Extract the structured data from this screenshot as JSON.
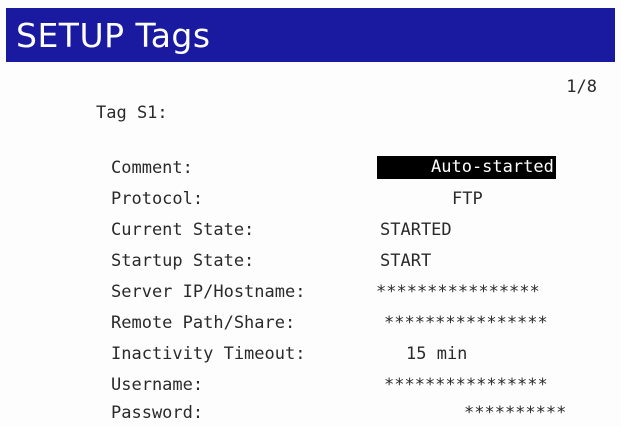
{
  "header": {
    "title": "SETUP Tags"
  },
  "page_indicator": "1/8",
  "tag_header": "Tag S1:",
  "fields": [
    {
      "label": "Comment:",
      "value": "Auto-started"
    },
    {
      "label": "Protocol:",
      "value": "FTP"
    },
    {
      "label": "Current State:",
      "value": "STARTED"
    },
    {
      "label": "Startup State:",
      "value": "START"
    },
    {
      "label": "Server IP/Hostname:",
      "value": "****************"
    },
    {
      "label": "Remote Path/Share:",
      "value": "****************"
    },
    {
      "label": "Inactivity Timeout:",
      "value": "15 min"
    },
    {
      "label": "Username:",
      "value": "****************"
    },
    {
      "label": "Password:",
      "value": "**********"
    }
  ]
}
